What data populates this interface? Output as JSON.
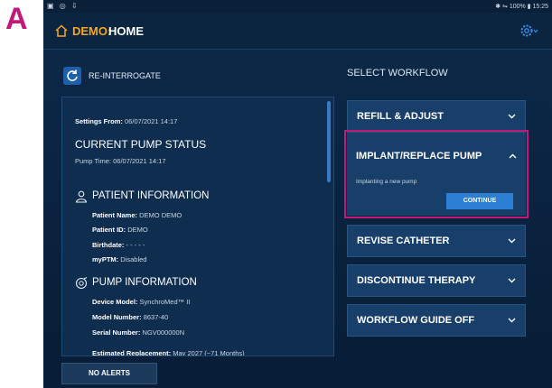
{
  "panel_label": "A",
  "status_bar": {
    "left_icons": "▣ ◎ ⇩",
    "right_text": "✱ ⇋ 100% ▮ 15:25"
  },
  "header": {
    "title_accent": "DEMO:",
    "title_main": "HOME",
    "icons": [
      "home-icon",
      "gear-icon"
    ]
  },
  "reinterrogate": {
    "label": "RE-INTERROGATE"
  },
  "status_card": {
    "settings_from_label": "Settings From:",
    "settings_from_value": "06/07/2021 14:17",
    "current_status_title": "CURRENT PUMP STATUS",
    "pump_time_label": "Pump Time:",
    "pump_time_value": "06/07/2021 14:17",
    "patient_section_title": "PATIENT INFORMATION",
    "patient_fields": [
      {
        "label": "Patient Name:",
        "value": "DEMO DEMO"
      },
      {
        "label": "Patient ID:",
        "value": "DEMO"
      },
      {
        "label": "Birthdate:",
        "value": "- - - - -"
      },
      {
        "label": "myPTM:",
        "value": "Disabled"
      }
    ],
    "pump_section_title": "PUMP INFORMATION",
    "pump_fields": [
      {
        "label": "Device Model:",
        "value": "SynchroMed™ II"
      },
      {
        "label": "Model Number:",
        "value": "8637-40"
      },
      {
        "label": "Serial Number:",
        "value": "NGV000000N"
      },
      {
        "label": "Estimated Replacement:",
        "value": "May 2027 (~71 Months)"
      }
    ]
  },
  "footer": {
    "no_alerts_label": "NO ALERTS"
  },
  "workflow": {
    "heading": "SELECT WORKFLOW",
    "items": [
      {
        "label": "REFILL & ADJUST",
        "expanded": false
      },
      {
        "label": "IMPLANT/REPLACE PUMP",
        "expanded": true,
        "description": "Implanting a new pump",
        "button": "CONTINUE"
      },
      {
        "label": "REVISE CATHETER",
        "expanded": false
      },
      {
        "label": "DISCONTINUE THERAPY",
        "expanded": false
      },
      {
        "label": "WORKFLOW GUIDE OFF",
        "expanded": false
      }
    ]
  },
  "colors": {
    "accent": "#f5a623",
    "highlight": "#c2187a",
    "button_blue": "#2d7fd6",
    "background": "#0b2440"
  }
}
